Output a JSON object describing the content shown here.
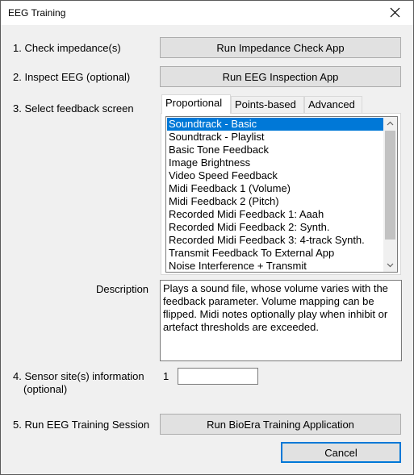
{
  "window": {
    "title": "EEG Training"
  },
  "steps": {
    "step1_label": "1. Check impedance(s)",
    "step1_button": "Run Impedance Check App",
    "step2_label": "2. Inspect EEG (optional)",
    "step2_button": "Run EEG Inspection App",
    "step3_label": "3. Select feedback screen",
    "step4_label_line1": "4. Sensor site(s) information",
    "step4_label_line2": "(optional)",
    "step4_index": "1",
    "step4_value": "",
    "step5_label": "5. Run EEG Training Session",
    "step5_button": "Run BioEra Training Application"
  },
  "tabs": [
    {
      "label": "Proportional",
      "active": true
    },
    {
      "label": "Points-based",
      "active": false
    },
    {
      "label": "Advanced",
      "active": false
    }
  ],
  "feedback_list": {
    "selected_index": 0,
    "items": [
      "Soundtrack - Basic",
      "Soundtrack - Playlist",
      "Basic Tone Feedback",
      "Image Brightness",
      "Video Speed Feedback",
      "Midi Feedback 1 (Volume)",
      "Midi Feedback 2 (Pitch)",
      "Recorded Midi Feedback 1: Aaah",
      "Recorded Midi Feedback 2: Synth.",
      "Recorded Midi Feedback 3: 4-track Synth.",
      "Transmit Feedback To External App",
      "Noise Interference + Transmit"
    ]
  },
  "description": {
    "label": "Description",
    "text": "Plays a sound file, whose volume varies with the feedback parameter. Volume mapping can be flipped. Midi notes optionally play when inhibit or artefact thresholds are exceeded."
  },
  "footer": {
    "cancel_label": "Cancel"
  },
  "colors": {
    "accent": "#0078d7",
    "face": "#f0f0f0",
    "button": "#e1e1e1"
  }
}
